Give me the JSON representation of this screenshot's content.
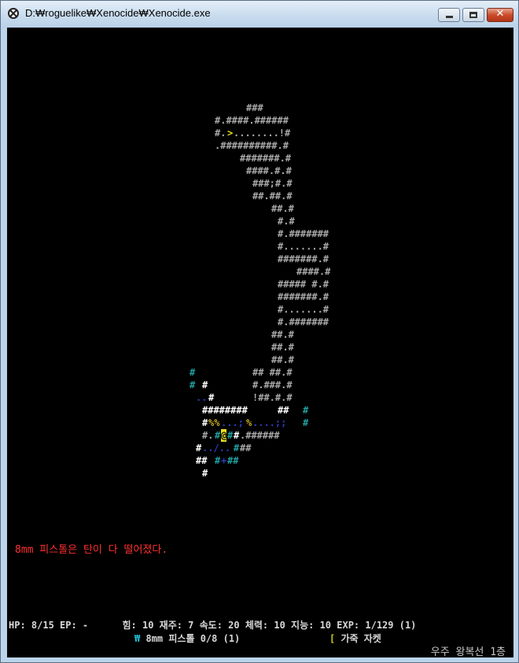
{
  "window": {
    "title": "D:₩roguelike₩Xenocide₩Xenocide.exe",
    "minimize_label": "–",
    "maximize_label": "",
    "close_label": "✕"
  },
  "colors": {
    "wall": "#a8a8a8",
    "wall_lit": "#ffffff",
    "wall_teal": "#20a0a0",
    "floor_dark": "#2c3cc0",
    "stairs": "#e8e020",
    "item_yellow": "#c8b020",
    "player": "#ffffff",
    "message": "#ff3030"
  },
  "map": {
    "rows": [
      {
        "segments": [
          {
            "text": "###",
            "col": 54,
            "color": "wall"
          }
        ]
      },
      {
        "segments": [
          {
            "text": "#.####.######",
            "col": 49,
            "color": "wall"
          }
        ]
      },
      {
        "segments": [
          {
            "text": "#.",
            "col": 49,
            "color": "wall"
          },
          {
            "text": ">",
            "col": 51,
            "color": "stairs"
          },
          {
            "text": "........!#",
            "col": 52,
            "color": "wall"
          }
        ]
      },
      {
        "segments": [
          {
            "text": ".##########.#",
            "col": 49,
            "color": "wall"
          }
        ]
      },
      {
        "segments": [
          {
            "text": "#######.#",
            "col": 53,
            "color": "wall"
          }
        ]
      },
      {
        "segments": [
          {
            "text": "####.#.#",
            "col": 54,
            "color": "wall"
          }
        ]
      },
      {
        "segments": [
          {
            "text": "###;#.#",
            "col": 55,
            "color": "wall"
          }
        ]
      },
      {
        "segments": [
          {
            "text": "##.##.#",
            "col": 55,
            "color": "wall"
          }
        ]
      },
      {
        "segments": [
          {
            "text": "##.#",
            "col": 58,
            "color": "wall"
          }
        ]
      },
      {
        "segments": [
          {
            "text": "#.#",
            "col": 59,
            "color": "wall"
          }
        ]
      },
      {
        "segments": [
          {
            "text": "#.#######",
            "col": 59,
            "color": "wall"
          }
        ]
      },
      {
        "segments": [
          {
            "text": "#.......#",
            "col": 59,
            "color": "wall"
          }
        ]
      },
      {
        "segments": [
          {
            "text": "#######.#",
            "col": 59,
            "color": "wall"
          }
        ]
      },
      {
        "segments": [
          {
            "text": "####.#",
            "col": 62,
            "color": "wall"
          }
        ]
      },
      {
        "segments": [
          {
            "text": "##### #.#",
            "col": 59,
            "color": "wall"
          }
        ]
      },
      {
        "segments": [
          {
            "text": "#######.#",
            "col": 59,
            "color": "wall"
          }
        ]
      },
      {
        "segments": [
          {
            "text": "#.......#",
            "col": 59,
            "color": "wall"
          }
        ]
      },
      {
        "segments": [
          {
            "text": "#.#######",
            "col": 59,
            "color": "wall"
          }
        ]
      },
      {
        "segments": [
          {
            "text": "##.#",
            "col": 58,
            "color": "wall"
          }
        ]
      },
      {
        "segments": [
          {
            "text": "##.#",
            "col": 58,
            "color": "wall"
          }
        ]
      },
      {
        "segments": [
          {
            "text": "##.#",
            "col": 58,
            "color": "wall"
          }
        ]
      },
      {
        "segments": [
          {
            "text": "#",
            "col": 45,
            "color": "wall_teal"
          },
          {
            "text": "## ##.#",
            "col": 55,
            "color": "wall"
          }
        ]
      },
      {
        "segments": [
          {
            "text": "#",
            "col": 45,
            "color": "wall_teal"
          },
          {
            "text": "#",
            "col": 47,
            "color": "wall_lit"
          },
          {
            "text": "#.###.#",
            "col": 55,
            "color": "wall"
          }
        ]
      },
      {
        "segments": [
          {
            "text": "..",
            "col": 46,
            "color": "floor_dark"
          },
          {
            "text": "#",
            "col": 48,
            "color": "wall_lit"
          },
          {
            "text": "!##.#.#",
            "col": 55,
            "color": "wall"
          }
        ]
      },
      {
        "segments": [
          {
            "text": "########",
            "col": 47,
            "color": "wall_lit"
          },
          {
            "text": "##",
            "col": 59,
            "color": "wall_lit"
          },
          {
            "text": "#",
            "col": 63,
            "color": "wall_teal"
          }
        ]
      },
      {
        "segments": [
          {
            "text": "#",
            "col": 47,
            "color": "wall_lit"
          },
          {
            "text": "%%",
            "col": 48,
            "color": "item_yellow"
          },
          {
            "text": "...;",
            "col": 50,
            "color": "floor_dark"
          },
          {
            "text": "%",
            "col": 54,
            "color": "item_yellow"
          },
          {
            "text": "....;;",
            "col": 55,
            "color": "floor_dark"
          },
          {
            "text": "#",
            "col": 63,
            "color": "wall_teal"
          }
        ]
      },
      {
        "segments": [
          {
            "text": "#.",
            "col": 47,
            "color": "wall"
          },
          {
            "text": "#",
            "col": 49,
            "color": "wall_teal"
          },
          {
            "text": "@",
            "col": 50,
            "color": "player"
          },
          {
            "text": "#",
            "col": 51,
            "color": "wall_teal"
          },
          {
            "text": "#",
            "col": 52,
            "color": "wall_lit"
          },
          {
            "text": ".######",
            "col": 53,
            "color": "wall"
          }
        ]
      },
      {
        "segments": [
          {
            "text": "#",
            "col": 46,
            "color": "wall_lit"
          },
          {
            "text": "../..",
            "col": 47,
            "color": "floor_dark"
          },
          {
            "text": "#",
            "col": 52,
            "color": "wall_teal"
          },
          {
            "text": "##",
            "col": 53,
            "color": "wall"
          }
        ]
      },
      {
        "segments": [
          {
            "text": "##",
            "col": 46,
            "color": "wall_lit"
          },
          {
            "text": "#",
            "col": 49,
            "color": "wall_teal"
          },
          {
            "text": "+",
            "col": 50,
            "color": "floor_dark"
          },
          {
            "text": "##",
            "col": 51,
            "color": "wall_teal"
          }
        ]
      },
      {
        "segments": [
          {
            "text": "#",
            "col": 47,
            "color": "wall_lit"
          }
        ]
      }
    ]
  },
  "message": "8mm 피스톨은 탄이 다 떨어졌다.",
  "status": {
    "line": "HP: 8/15 EP: -      힘: 10 재주: 7 속도: 20 체력: 10 지능: 10 EXP: 1/129 (1)",
    "weapon_symbol": "₩",
    "weapon": " 8mm 피스톨 0/8 (1)",
    "armor_symbol": "[",
    "armor": " 가죽 자켓",
    "location": "우주 왕복선 1층"
  }
}
